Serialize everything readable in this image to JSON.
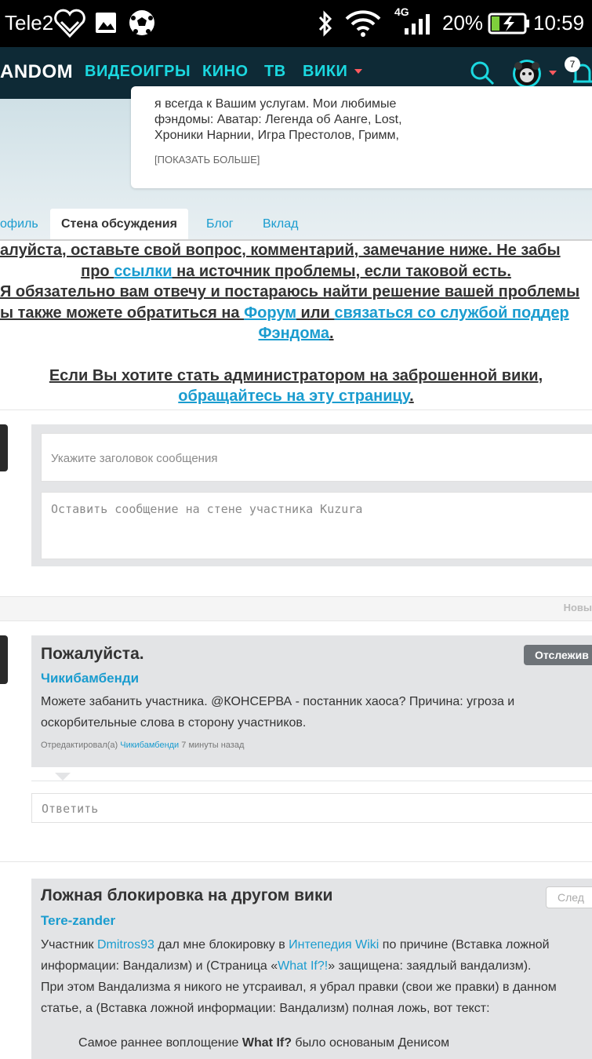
{
  "statusbar": {
    "carrier": "Tele2",
    "network": "4G",
    "battery": "20%",
    "time": "10:59"
  },
  "nav": {
    "logo": "ANDOM",
    "items": [
      "ВИДЕОИГРЫ",
      "КИНО",
      "ТВ",
      "ВИКИ"
    ],
    "notifications": "7"
  },
  "bio": {
    "lines": [
      "я всегда к Вашим услугам. Мои любимые",
      "фэндомы: Аватар: Легенда об Аанге, Lost,",
      "Хроники Нарнии, Игра Престолов, Гримм,"
    ],
    "show_more": "[ПОКАЗАТЬ БОЛЬШЕ]"
  },
  "tabs": [
    "офиль",
    "Стена обсуждения",
    "Блог",
    "Вклад"
  ],
  "notice": {
    "l1": "алуйста, оставьте свой вопрос, комментарий, замечание ниже. Не забы",
    "l2a": "про ",
    "l2link": "ссылки",
    "l2b": " на источник проблемы, если таковой есть.",
    "l3": "Я обязательно вам отвечу и постараюсь найти решение вашей проблемы",
    "l4a": "ы также можете обратиться на ",
    "l4link1": "Форум",
    "l4b": " или ",
    "l4link2": "связаться со службой поддер",
    "l5link": "Фэндома",
    "l5b": ".",
    "l6": "Если Вы хотите стать администратором на заброшенной вики,",
    "l7link": "обращайтесь на эту страницу",
    "l7b": "."
  },
  "composer": {
    "title_placeholder": "Укажите заголовок сообщения",
    "body_placeholder": "Оставить сообщение на стене участника Kuzura"
  },
  "sort_label": "Новы",
  "threads": [
    {
      "title": "Пожалуйста.",
      "author": "Чикибамбенди",
      "follow": "Отслежив",
      "body1": "Можете забанить участника. @КОНСЕРВА - постанник хаоса? Причина: угроза и",
      "body2": "оскорбительные слова в сторону участников.",
      "edited_prefix": "Отредактировал(а) ",
      "edited_by": "Чикибамбенди",
      "edited_time": " 7 минуты назад",
      "reply_placeholder": "Ответить"
    },
    {
      "title": "Ложная блокировка на другом вики",
      "author": "Tere-zander",
      "follow": "След",
      "body1a": "Участник ",
      "body1l1": "Dmitros93",
      "body1b": " дал мне блокировку в ",
      "body1l2": "Интепедия Wiki",
      "body1c": " по причине (Вставка ложной",
      "body2a": "информации: Вандализм) и (Страница «",
      "body2l": "What If?!",
      "body2b": "» защищена: заядлый вандализм).",
      "body3": "При этом Вандализма я никого не утсраивал, я убрал правки (свои же правки) в данном",
      "body4": "статье, а (Вставка ложной информации: Вандализм) полная ложь, вот текст:",
      "quote_a": "Самое раннее воплощение ",
      "quote_b": "What If?",
      "quote_c": " было основаным Денисом"
    }
  ]
}
